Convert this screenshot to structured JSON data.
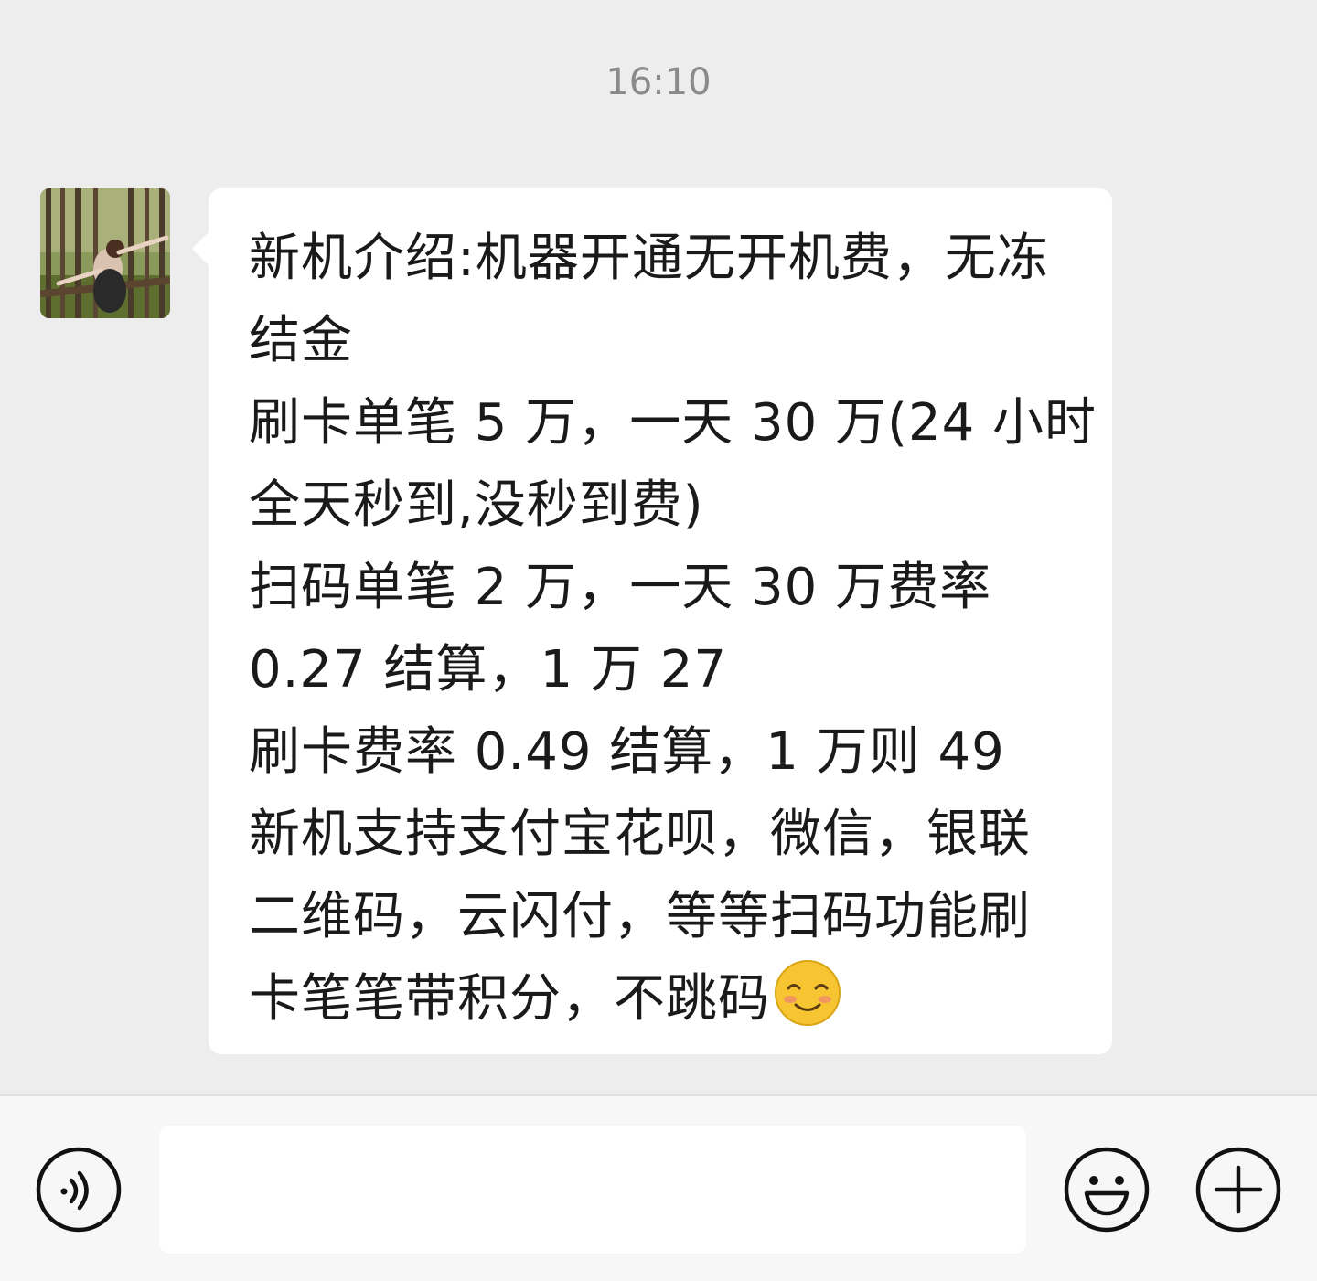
{
  "chat": {
    "timestamp": "16:10",
    "avatar_icon": "forest-person-photo",
    "message": {
      "lines": [
        "新机介绍:机器开通无开机费，无冻",
        "结金",
        "刷卡单笔 5 万，一天 30 万(24 小时",
        "全天秒到,没秒到费)",
        "扫码单笔 2 万，一天 30 万费率",
        "0.27 结算，1 万 27",
        "刷卡费率 0.49 结算，1 万则 49",
        "新机支持支付宝花呗，微信，银联",
        "二维码，云闪付，等等扫码功能刷",
        "卡笔笔带积分，不跳码"
      ],
      "trailing_emoji": "smiling-blush-emoji"
    }
  },
  "input_bar": {
    "voice_icon": "voice-icon",
    "text_value": "",
    "emoji_icon": "smiley-icon",
    "plus_icon": "plus-icon"
  },
  "colors": {
    "background": "#ededed",
    "bubble": "#ffffff",
    "timestamp": "#8a8a8a",
    "text": "#1a1a1a"
  }
}
